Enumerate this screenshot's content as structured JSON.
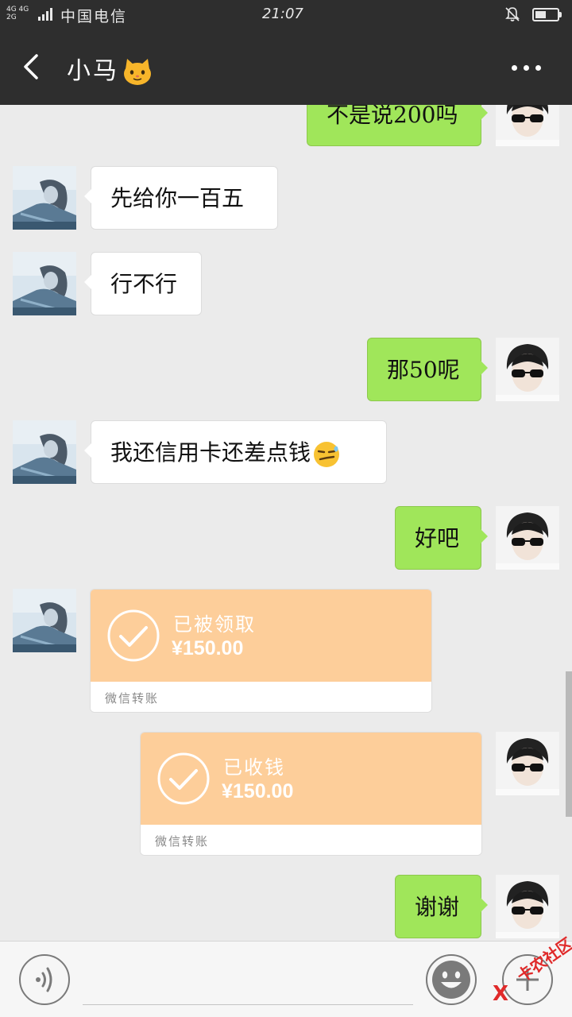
{
  "status_bar": {
    "network_top": "4G 4G",
    "network_bottom": "2G",
    "carrier": "中国电信",
    "time": "21:07",
    "battery_level": 0.5
  },
  "header": {
    "title": "小马",
    "title_emoji": "cat-face-icon",
    "back_icon": "chevron-left-icon",
    "more_icon": "more-dots-icon"
  },
  "messages": [
    {
      "direction": "out",
      "text": "不是说200吗"
    },
    {
      "direction": "in",
      "text": "先给你一百五"
    },
    {
      "direction": "in",
      "text": "行不行"
    },
    {
      "direction": "out",
      "text": "那50呢"
    },
    {
      "direction": "in",
      "text": "我还信用卡还差点钱",
      "emoji": "smirk-face-icon"
    },
    {
      "direction": "out",
      "text": "好吧"
    },
    {
      "direction": "in",
      "type": "transfer",
      "status": "已被领取",
      "amount": "¥150.00",
      "label": "微信转账"
    },
    {
      "direction": "out",
      "type": "transfer",
      "status": "已收钱",
      "amount": "¥150.00",
      "label": "微信转账"
    },
    {
      "direction": "out",
      "text": "谢谢"
    }
  ],
  "input_bar": {
    "voice_icon": "voice-icon",
    "emoji_icon": "emoji-icon",
    "plus_icon": "plus-icon",
    "input_value": ""
  },
  "watermark": {
    "text": "卡农社区",
    "mark": "X"
  },
  "colors": {
    "header_bg": "#2e2e2e",
    "chat_bg": "#ebebeb",
    "outgoing_bubble": "#a0e65a",
    "incoming_bubble": "#ffffff",
    "transfer_card": "#fdce9a"
  }
}
